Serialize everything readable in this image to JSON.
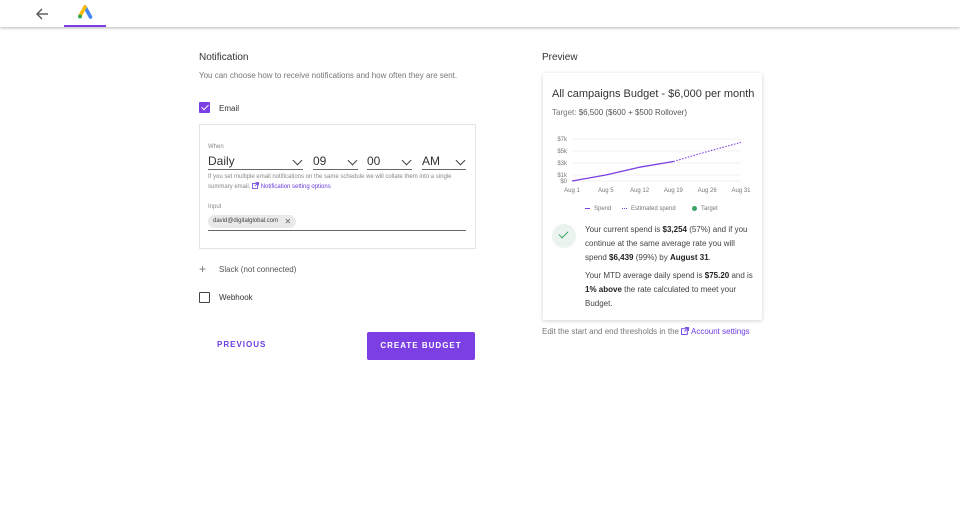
{
  "header": {
    "back_icon": "arrow-left-icon",
    "logo_icon": "google-ads-logo"
  },
  "notification": {
    "title": "Notification",
    "subtitle": "You can choose how to receive notifications and how often they are sent.",
    "email": {
      "label": "Email",
      "checked": true,
      "when_label": "When",
      "frequency": "Daily",
      "hour": "09",
      "minute": "00",
      "ampm": "AM",
      "hint": "If you set multiple email notifications on the same schedule we will collate them into a single summary email.",
      "hint_link": "Notification setting options",
      "input_label": "Input",
      "recipient": "david@digitalglobal.com"
    },
    "slack_label": "Slack (not connected)",
    "webhook": {
      "label": "Webhook",
      "checked": false
    }
  },
  "actions": {
    "previous_label": "PREVIOUS",
    "create_label": "CREATE BUDGET"
  },
  "preview": {
    "title": "Preview",
    "card_title": "All campaigns Budget - $6,000 per month",
    "target_prefix": "Target: ",
    "target_value": "$6,500 ($600 + $500 Rollover)",
    "legend": {
      "spend": "Spend",
      "estimated": "Estimated spend",
      "target": "Target"
    },
    "summary1": {
      "a": "Your current spend is ",
      "b": "$3,254",
      "c": " (57%) and if you continue at the same average rate you will spend ",
      "d": "$6,439",
      "e": " (99%) by ",
      "f": "August 31",
      "g": "."
    },
    "summary2": {
      "a": "Your MTD average daily spend is ",
      "b": "$75.20",
      "c": " and is ",
      "d": "1% above",
      "e": " the rate calculated to meet your Budget."
    },
    "footnote": "Edit the start and end thresholds in the ",
    "footnote_link": "Account settings"
  },
  "colors": {
    "accent": "#7b3fe4",
    "target": "#3aa565"
  },
  "chart_data": {
    "type": "line",
    "x": [
      "Aug 1",
      "Aug 5",
      "Aug 12",
      "Aug 19",
      "Aug 26",
      "Aug 31"
    ],
    "y_ticks": [
      "$7k",
      "$5k",
      "$3k",
      "$1k",
      "$0"
    ],
    "ylim": [
      0,
      8000
    ],
    "series": [
      {
        "name": "Spend",
        "values": [
          0,
          1000,
          2300,
          3254,
          null,
          null
        ]
      },
      {
        "name": "Estimated spend",
        "values": [
          null,
          null,
          null,
          3254,
          4900,
          6439
        ]
      }
    ]
  }
}
